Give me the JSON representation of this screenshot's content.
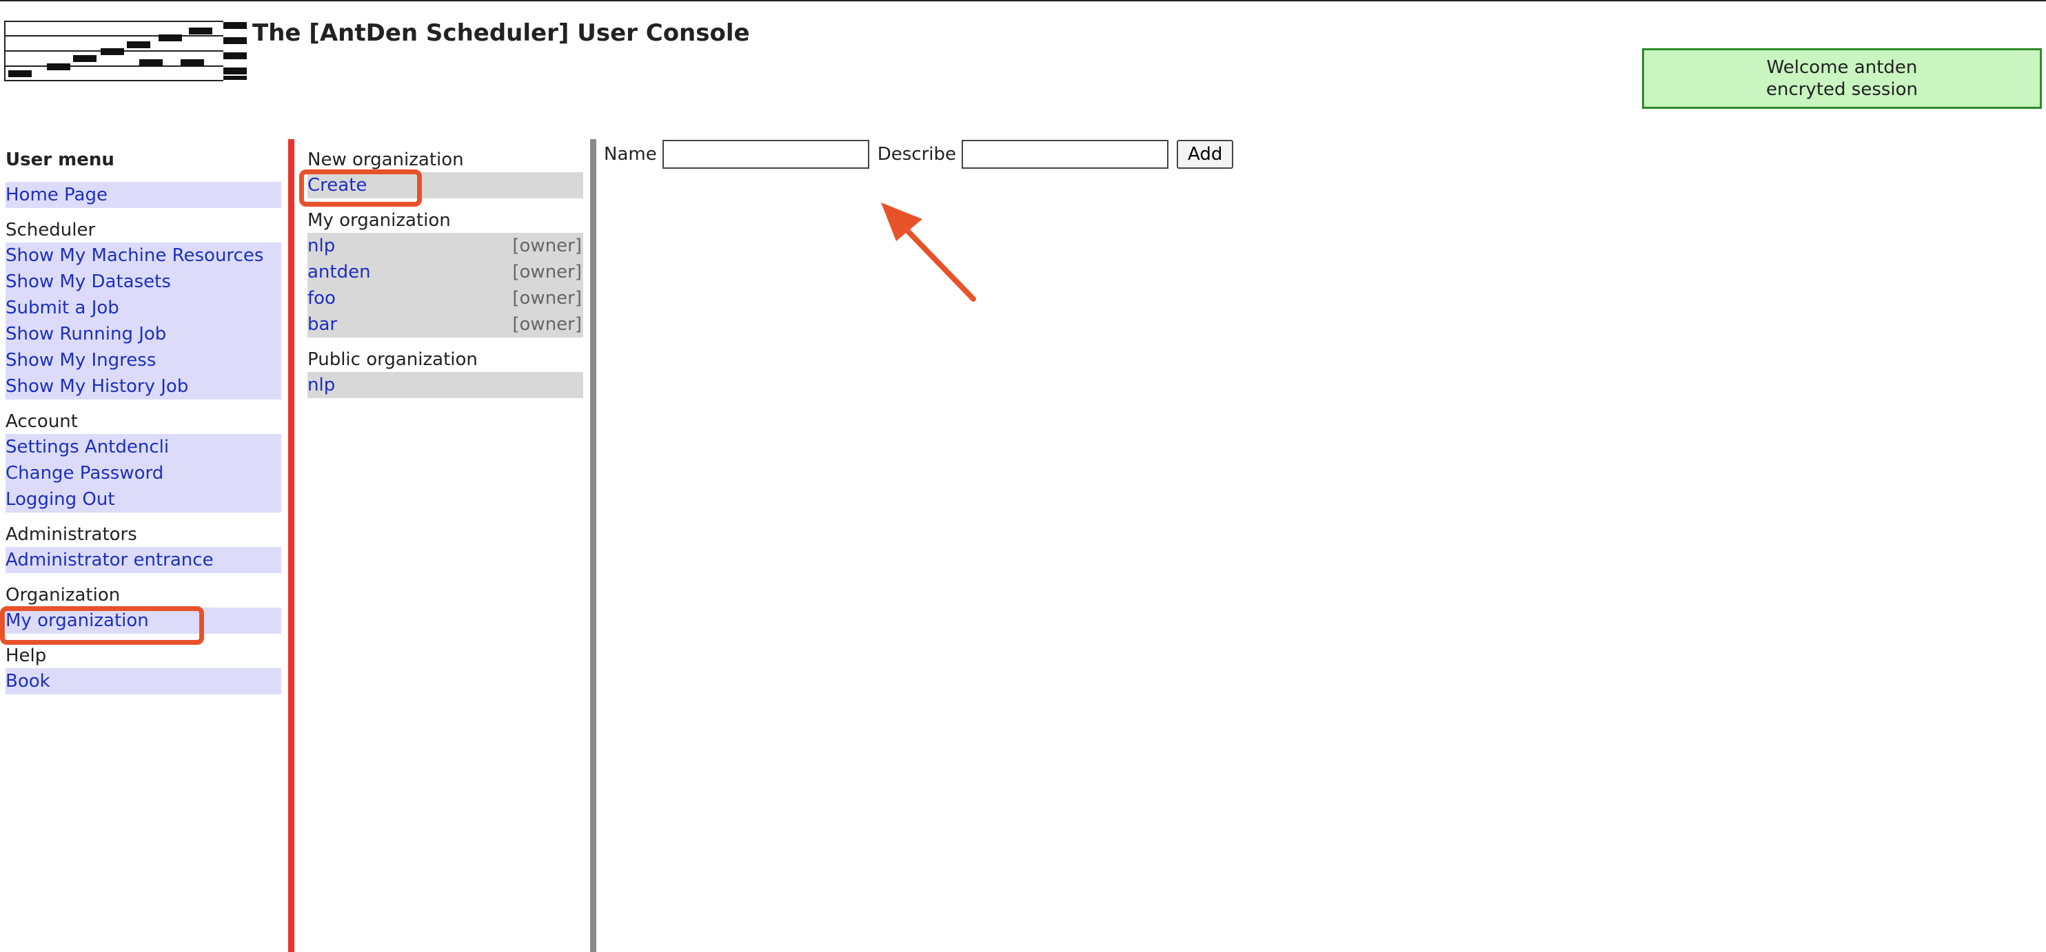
{
  "header": {
    "title": "The [AntDen Scheduler] User Console",
    "welcome_line1": "Welcome antden",
    "welcome_line2": "encryted session"
  },
  "menu": {
    "title": "User menu",
    "home": "Home Page",
    "sections": [
      {
        "title": "Scheduler",
        "items": [
          "Show My Machine Resources",
          "Show My Datasets",
          "Submit a Job",
          "Show Running Job",
          "Show My Ingress",
          "Show My History Job"
        ]
      },
      {
        "title": "Account",
        "items": [
          "Settings Antdencli",
          "Change Password",
          "Logging Out"
        ]
      },
      {
        "title": "Administrators",
        "items": [
          "Administrator entrance"
        ]
      },
      {
        "title": "Organization",
        "items": [
          "My organization"
        ]
      },
      {
        "title": "Help",
        "items": [
          "Book"
        ]
      }
    ]
  },
  "org_panel": {
    "new_title": "New organization",
    "create_label": "Create",
    "my_title": "My organization",
    "my_orgs": [
      {
        "name": "nlp",
        "role": "[owner]"
      },
      {
        "name": "antden",
        "role": "[owner]"
      },
      {
        "name": "foo",
        "role": "[owner]"
      },
      {
        "name": "bar",
        "role": "[owner]"
      }
    ],
    "public_title": "Public organization",
    "public_orgs": [
      "nlp"
    ]
  },
  "form": {
    "name_label": "Name",
    "name_value": "",
    "describe_label": "Describe",
    "describe_value": "",
    "add_label": "Add"
  },
  "colors": {
    "link": "#1d2fbf",
    "menu_bg": "#dcdcfa",
    "org_bg": "#d8d8d8",
    "welcome_bg": "#c8f5c0",
    "divider_red": "#e8342c",
    "annotation": "#e8522a"
  }
}
